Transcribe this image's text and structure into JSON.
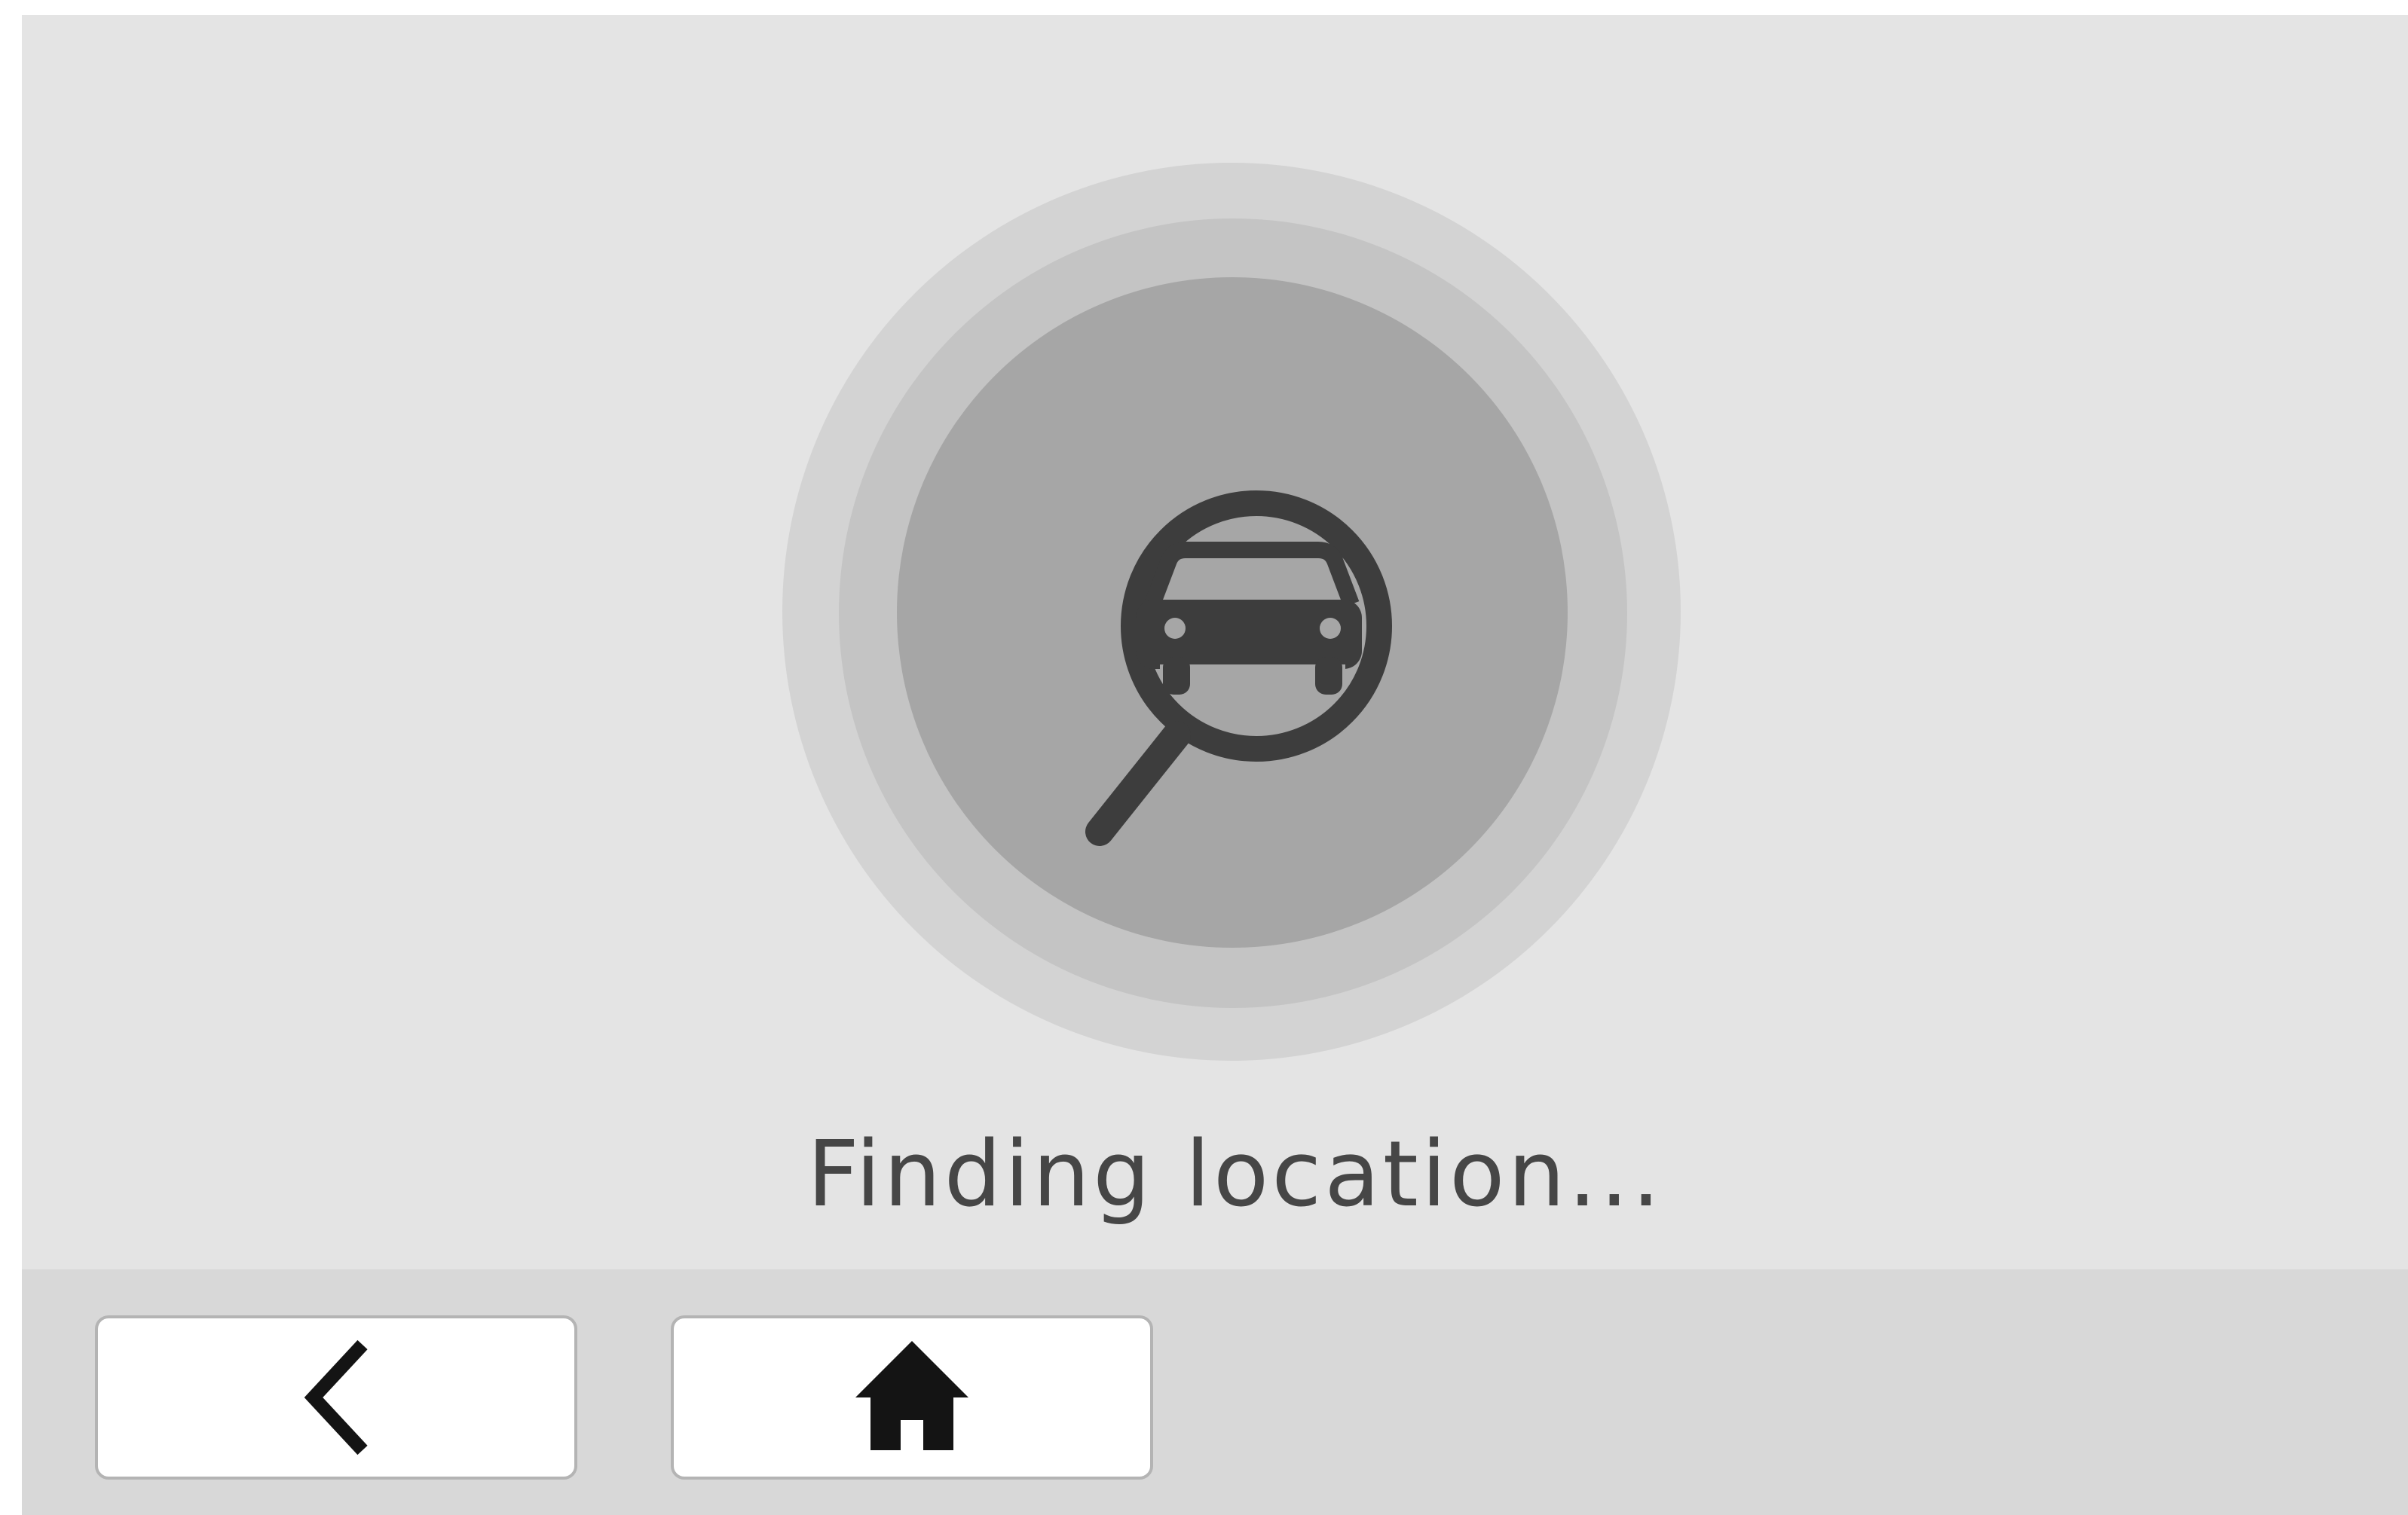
{
  "status": {
    "text": "Finding location..."
  },
  "icons": {
    "status_icon": "car-search-icon",
    "back": "chevron-left-icon",
    "home": "home-icon"
  },
  "colors": {
    "background": "#e4e4e4",
    "bottom_bar": "#d8d8d8",
    "ring_outer": "#d3d3d3",
    "ring_middle": "#c4c4c4",
    "ring_inner": "#a6a6a6",
    "icon": "#3d3d3d",
    "text": "#464646",
    "button_bg": "#ffffff"
  }
}
